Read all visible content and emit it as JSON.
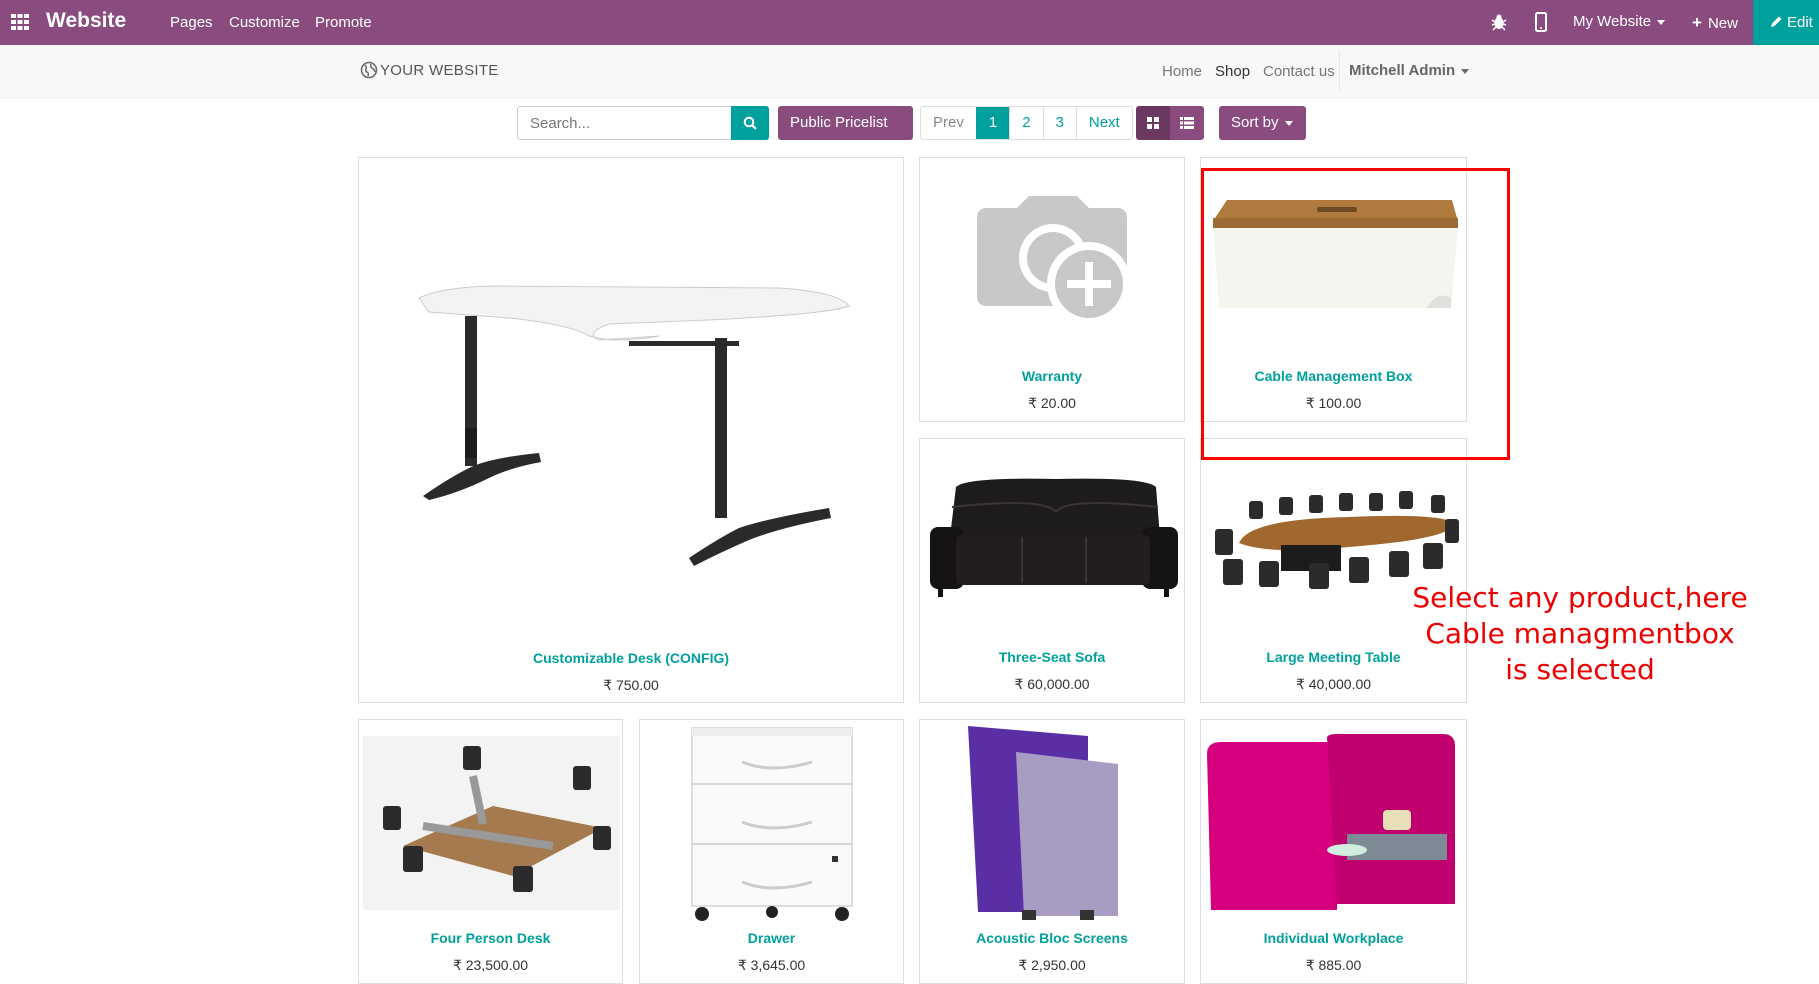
{
  "topbar": {
    "brand": "Website",
    "menu": [
      "Pages",
      "Customize",
      "Promote"
    ],
    "my_website": "My Website",
    "new_label": "New",
    "edit_label": "Edit"
  },
  "navbar": {
    "logo": "YOUR WEBSITE",
    "links": [
      "Home",
      "Shop",
      "Contact us"
    ],
    "user": "Mitchell Admin"
  },
  "toolbar": {
    "search_placeholder": "Search...",
    "pricelist": "Public Pricelist",
    "pager": [
      "Prev",
      "1",
      "2",
      "3",
      "Next"
    ],
    "sort_by": "Sort by"
  },
  "products": [
    {
      "name": "Customizable Desk (CONFIG)",
      "price": "₹ 750.00"
    },
    {
      "name": "Warranty",
      "price": "₹ 20.00"
    },
    {
      "name": "Cable Management Box",
      "price": "₹ 100.00"
    },
    {
      "name": "Three-Seat Sofa",
      "price": "₹ 60,000.00"
    },
    {
      "name": "Large Meeting Table",
      "price": "₹ 40,000.00"
    },
    {
      "name": "Four Person Desk",
      "price": "₹ 23,500.00"
    },
    {
      "name": "Drawer",
      "price": "₹ 3,645.00"
    },
    {
      "name": "Acoustic Bloc Screens",
      "price": "₹ 2,950.00"
    },
    {
      "name": "Individual Workplace",
      "price": "₹ 885.00"
    }
  ],
  "annotation": {
    "lines": [
      "Select any product,here",
      "Cable managmentbox",
      "is selected"
    ],
    "color": "#ee0000"
  },
  "colors": {
    "brand": "#8a4c7f",
    "accent": "#00a09d"
  }
}
